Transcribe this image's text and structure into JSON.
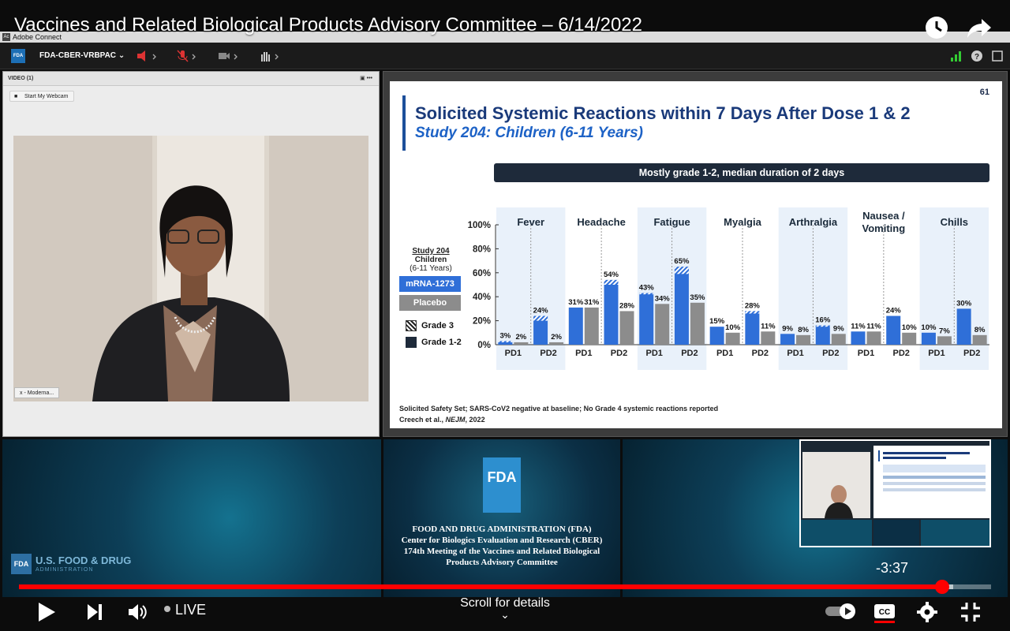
{
  "video": {
    "title": "Vaccines and Related Biological Products Advisory Committee – 6/14/2022",
    "time_remaining": "-3:37",
    "live_label": "LIVE",
    "scroll_hint": "Scroll for details",
    "progress_fraction": 0.95
  },
  "app": {
    "window_title": "Adobe Connect",
    "logo_text": "Ac",
    "room_name": "FDA-CBER-VRBPAC",
    "room_logo": "FDA"
  },
  "video_pod": {
    "header": "VIDEO (1)",
    "webcam_button": "Start My Webcam",
    "name_tag": "x - Moderna..."
  },
  "slide": {
    "number": "61",
    "title": "Solicited Systemic Reactions within 7 Days After Dose 1 & 2",
    "subtitle": "Study 204: Children (6-11 Years)",
    "banner": "Mostly grade 1-2, median duration of 2 days",
    "legend": {
      "study": "Study 204",
      "group": "Children",
      "ages": "(6-11 Years)",
      "vaccine": "mRNA-1273",
      "placebo": "Placebo",
      "grade3": "Grade 3",
      "grade12": "Grade 1-2"
    },
    "footnote1": "Solicited Safety Set; SARS-CoV2 negative at baseline; No Grade 4 systemic reactions reported",
    "footnote2_prefix": "Creech et al., ",
    "footnote2_journal": "NEJM",
    "footnote2_suffix": ", 2022"
  },
  "chart_data": {
    "type": "bar",
    "title": "",
    "ylim": [
      0,
      100
    ],
    "yticks": [
      "0%",
      "20%",
      "40%",
      "60%",
      "80%",
      "100%"
    ],
    "categories": [
      "Fever",
      "Headache",
      "Fatigue",
      "Myalgia",
      "Arthralgia",
      "Nausea / Vomiting",
      "Chills"
    ],
    "doses": [
      "PD1",
      "PD2"
    ],
    "series": [
      {
        "name": "mRNA-1273",
        "color": "#2f6fd8",
        "PD1": [
          3,
          31,
          43,
          15,
          9,
          11,
          10
        ],
        "PD2": [
          24,
          54,
          65,
          28,
          16,
          24,
          30
        ]
      },
      {
        "name": "Placebo",
        "color": "#8c8c8c",
        "PD1": [
          2,
          31,
          34,
          10,
          8,
          11,
          7
        ],
        "PD2": [
          2,
          28,
          35,
          11,
          9,
          10,
          8
        ]
      }
    ],
    "grade3": {
      "mRNA-1273": {
        "PD1": [
          1,
          0,
          1,
          0,
          0,
          0,
          0
        ],
        "PD2": [
          4,
          4,
          6,
          2,
          1,
          0,
          0
        ]
      }
    }
  },
  "fda": {
    "lines": [
      "FOOD AND DRUG ADMINISTRATION (FDA)",
      "Center for Biologics Evaluation and Research (CBER)",
      "174th Meeting of the Vaccines and Related Biological",
      "Products Advisory Committee"
    ],
    "logo": "FDA",
    "left_title": "U.S. FOOD & DRUG",
    "left_sub": "ADMINISTRATION"
  },
  "colors": {
    "accent": "#ff0000",
    "slide_title": "#1a3a7a",
    "slide_sub": "#1d62c6",
    "banner": "#1e2a3a"
  }
}
